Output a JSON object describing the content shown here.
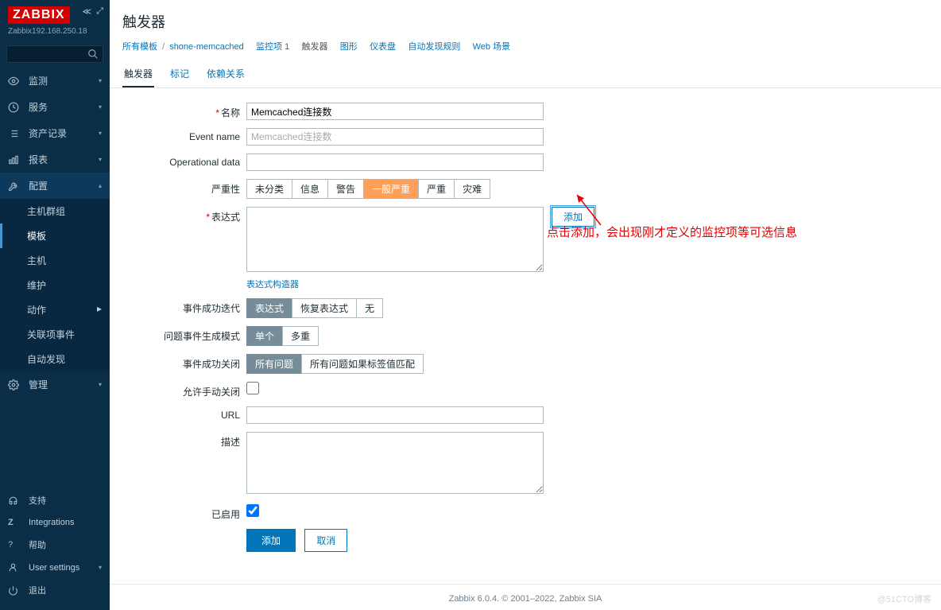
{
  "brand": {
    "logo": "ZABBIX",
    "host": "Zabbix192.168.250.18"
  },
  "search": {
    "placeholder": ""
  },
  "nav": {
    "monitoring": "监测",
    "services": "服务",
    "inventory": "资产记录",
    "reports": "报表",
    "config": "配置",
    "config_sub": {
      "hostgroups": "主机群组",
      "templates": "模板",
      "hosts": "主机",
      "maintenance": "维护",
      "actions": "动作",
      "correlation": "关联项事件",
      "discovery": "自动发现"
    },
    "admin": "管理"
  },
  "footer_nav": {
    "support": "支持",
    "integrations": "Integrations",
    "help": "帮助",
    "usersettings": "User settings",
    "signout": "退出"
  },
  "page": {
    "title": "触发器"
  },
  "breadcrumb": {
    "all_templates": "所有模板",
    "template": "shone-memcached",
    "items": "监控项 1",
    "triggers": "触发器",
    "graphs": "图形",
    "dashboards": "仪表盘",
    "discovery": "自动发现规则",
    "web": "Web 场景"
  },
  "tabs": {
    "trigger": "触发器",
    "tag": "标记",
    "deps": "依赖关系"
  },
  "form": {
    "name_label": "名称",
    "name_value": "Memcached连接数",
    "eventname_label": "Event name",
    "eventname_placeholder": "Memcached连接数",
    "opdata_label": "Operational data",
    "severity_label": "严重性",
    "sev": {
      "na": "未分类",
      "info": "信息",
      "warn": "警告",
      "avg": "一般严重",
      "high": "严重",
      "disaster": "灾难"
    },
    "expr_label": "表达式",
    "expr_add": "添加",
    "expr_builder": "表达式构造器",
    "okgen_label": "事件成功迭代",
    "okgen": {
      "expr": "表达式",
      "recexpr": "恢复表达式",
      "none": "无"
    },
    "problem_mode_label": "问题事件生成模式",
    "problem_mode": {
      "single": "单个",
      "multi": "多重"
    },
    "okclose_label": "事件成功关闭",
    "okclose": {
      "all": "所有问题",
      "tag": "所有问题如果标签值匹配"
    },
    "manual_close_label": "允许手动关闭",
    "url_label": "URL",
    "desc_label": "描述",
    "enabled_label": "已启用",
    "submit": "添加",
    "cancel": "取消"
  },
  "annotation": {
    "text": "点击添加，会出现刚才定义的监控项等可选信息"
  },
  "copyright": "Zabbix 6.0.4. © 2001–2022, Zabbix SIA",
  "watermark": "@51CTO博客"
}
